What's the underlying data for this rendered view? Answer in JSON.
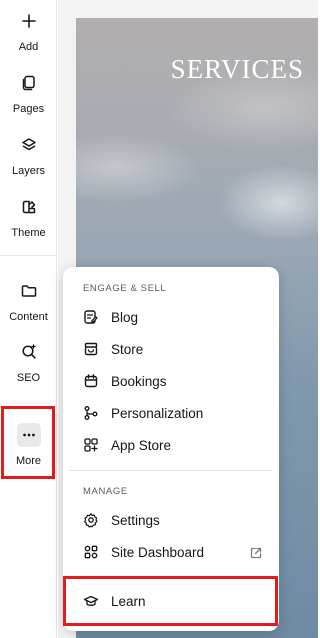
{
  "sidebar": {
    "items": [
      {
        "label": "Add",
        "icon": "plus-icon"
      },
      {
        "label": "Pages",
        "icon": "pages-icon"
      },
      {
        "label": "Layers",
        "icon": "layers-icon"
      },
      {
        "label": "Theme",
        "icon": "theme-icon"
      },
      {
        "label": "Content",
        "icon": "folder-icon"
      },
      {
        "label": "SEO",
        "icon": "seo-search-icon"
      },
      {
        "label": "More",
        "icon": "more-dots-icon"
      }
    ]
  },
  "canvas": {
    "hero_title": "SERVICES"
  },
  "more_menu": {
    "sections": [
      {
        "title": "ENGAGE & SELL",
        "items": [
          {
            "label": "Blog",
            "icon": "blog-icon"
          },
          {
            "label": "Store",
            "icon": "store-icon"
          },
          {
            "label": "Bookings",
            "icon": "calendar-icon"
          },
          {
            "label": "Personalization",
            "icon": "personalization-icon"
          },
          {
            "label": "App Store",
            "icon": "app-store-icon"
          }
        ]
      },
      {
        "title": "MANAGE",
        "items": [
          {
            "label": "Settings",
            "icon": "gear-icon"
          },
          {
            "label": "Site Dashboard",
            "icon": "dashboard-icon"
          }
        ]
      }
    ],
    "footer_item": {
      "label": "Learn",
      "icon": "graduation-cap-icon"
    }
  },
  "colors": {
    "highlight": "#e21c1c",
    "more_button_bg": "#e9e9ec",
    "hero_sky": "#7f98ad"
  }
}
